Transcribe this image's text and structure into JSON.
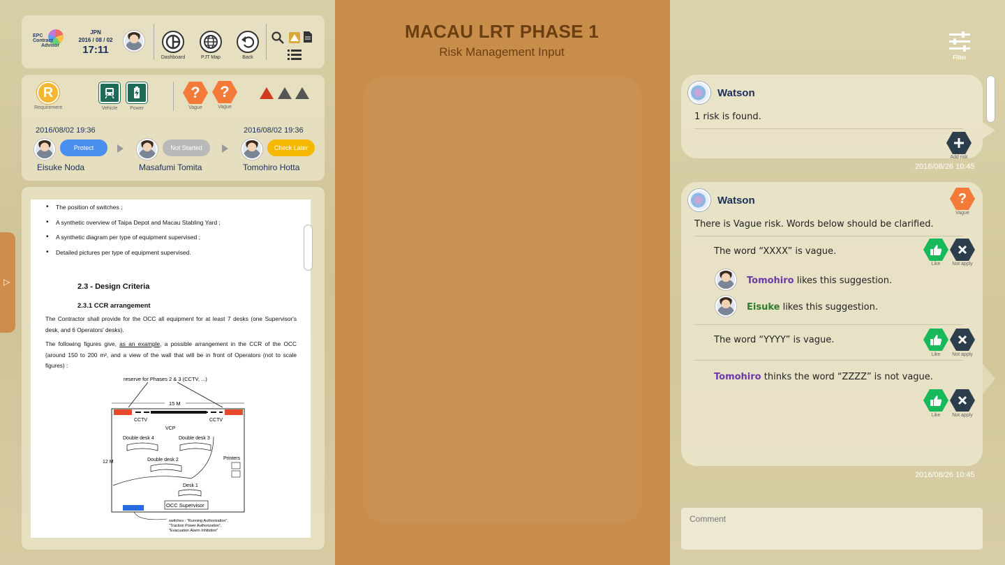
{
  "header": {
    "logo_lines": [
      "EPC",
      "Contract",
      "Advisor"
    ],
    "region": "JPN",
    "date": "2016 / 08 / 02",
    "time": "17:11",
    "nav": [
      {
        "label": "Dashboard",
        "icon": "dashboard-icon"
      },
      {
        "label": "PJT Map",
        "icon": "globe-icon"
      },
      {
        "label": "Back",
        "icon": "back-arrow-icon"
      }
    ]
  },
  "status": {
    "requirement_letter": "R",
    "requirement_label": "Requirement",
    "category_labels": [
      "Vehicle",
      "Power"
    ],
    "risk_mark": "?",
    "risk_labels": [
      "Vague",
      "Vague"
    ]
  },
  "workflow": {
    "steps": [
      {
        "date": "2016/08/02 19:36",
        "status": "Protect",
        "name": "Eisuke Noda",
        "color": "#4a8ef0"
      },
      {
        "date": "",
        "status": "Not Started",
        "name": "Masafumi Tomita",
        "color": "#b9b9b9"
      },
      {
        "date": "2016/08/02 19:36",
        "status": "Check Later",
        "name": "Tomohiro Hotta",
        "color": "#f5b800"
      }
    ]
  },
  "document": {
    "bullets": [
      "The position of switches ;",
      "A synthetic overview of Taipa Depot and Macau Stabling Yard ;",
      "A synthetic diagram per type of equipment supervised ;",
      "Detailed pictures per type of equipment supervised."
    ],
    "heading": "2.3 - Design Criteria",
    "subheading": "2.3.1 CCR arrangement",
    "para1": "The Contractor shall provide for the OCC all equipment for at least 7 desks (one Supervisor's desk, and 6 Operators' desks).",
    "para2_before": "The following figures give, ",
    "para2_link": "as an example",
    "para2_after": ", a possible arrangement in the CCR of the OCC (around 150 to 200 m², and a view of the wall that will be in front of Operators (not to scale figures) :",
    "diagram": {
      "reserve": "reserve for Phases 2 & 3 (CCTV, ...)",
      "width_label": "15 M",
      "height_label": "12 M",
      "cctv_left": "CCTV",
      "cctv_right": "CCTV",
      "vcp": "VCP",
      "desk4": "Double desk 4",
      "desk3": "Double desk 3",
      "desk2": "Double desk 2",
      "printers": "Printers",
      "desk1": "Desk 1",
      "supervisor": "OCC Supervisor",
      "switches_note": [
        "switches : \"Running Authorization\",",
        "\"Traction Power Authorization\",",
        "\"Evacuation Alarm Inhibition\""
      ]
    }
  },
  "center": {
    "title": "MACAU LRT PHASE 1",
    "subtitle": "Risk Management Input"
  },
  "filter_label": "Filter",
  "chat": {
    "card1": {
      "sender": "Watson",
      "message": "1 risk is found.",
      "action_label": "Add risk",
      "timestamp": "2016/08/26 10:45"
    },
    "card2": {
      "sender": "Watson",
      "badge_label": "Vague",
      "message": "There is Vague risk. Words below should be clarified.",
      "items": [
        {
          "text": "The word “XXXX” is vague."
        },
        {
          "text": "The word “YYYY” is vague."
        }
      ],
      "likes": [
        {
          "name": "Tomohiro",
          "rest": " likes this suggestion."
        },
        {
          "name": "Eisuke",
          "rest": " likes this suggestion."
        }
      ],
      "opinion": {
        "name": "Tomohiro",
        "rest": " thinks the word “ZZZZ” is not vague."
      },
      "like_label": "Like",
      "notapply_label": "Not apply",
      "timestamp": "2016/08/26 10:45"
    },
    "comment_placeholder": "Comment"
  }
}
